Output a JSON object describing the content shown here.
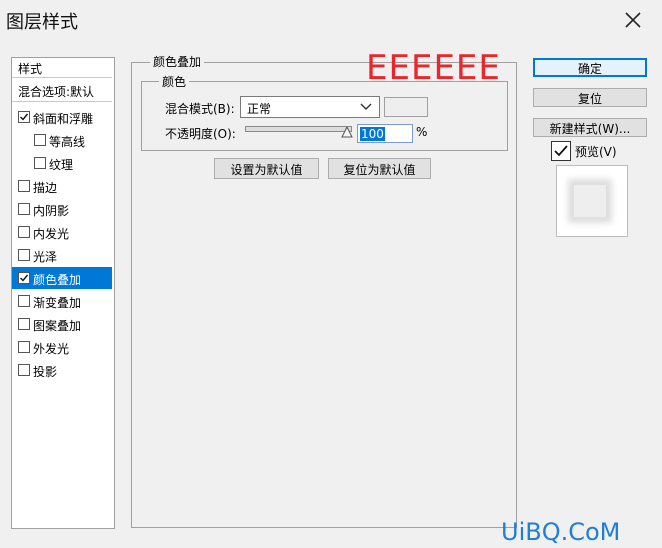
{
  "window": {
    "title": "图层样式"
  },
  "styles_panel": {
    "header": "样式",
    "blend_options": "混合选项:默认",
    "items": [
      {
        "label": "斜面和浮雕",
        "checked": true,
        "indent": false,
        "selected": false
      },
      {
        "label": "等高线",
        "checked": false,
        "indent": true,
        "selected": false
      },
      {
        "label": "纹理",
        "checked": false,
        "indent": true,
        "selected": false
      },
      {
        "label": "描边",
        "checked": false,
        "indent": false,
        "selected": false
      },
      {
        "label": "内阴影",
        "checked": false,
        "indent": false,
        "selected": false
      },
      {
        "label": "内发光",
        "checked": false,
        "indent": false,
        "selected": false
      },
      {
        "label": "光泽",
        "checked": false,
        "indent": false,
        "selected": false
      },
      {
        "label": "颜色叠加",
        "checked": true,
        "indent": false,
        "selected": true
      },
      {
        "label": "渐变叠加",
        "checked": false,
        "indent": false,
        "selected": false
      },
      {
        "label": "图案叠加",
        "checked": false,
        "indent": false,
        "selected": false
      },
      {
        "label": "外发光",
        "checked": false,
        "indent": false,
        "selected": false
      },
      {
        "label": "投影",
        "checked": false,
        "indent": false,
        "selected": false
      }
    ]
  },
  "color_overlay": {
    "group_title": "颜色叠加",
    "sub_group_title": "颜色",
    "blend_mode_label": "混合模式(B):",
    "blend_mode_value": "正常",
    "opacity_label": "不透明度(O):",
    "opacity_value": "100",
    "opacity_unit": "%",
    "opacity_fraction": 1.0,
    "overlay_color": "#eeeeee",
    "set_default_button": "设置为默认值",
    "reset_default_button": "复位为默认值"
  },
  "annotation": {
    "text": "EEEEEE",
    "color": "#e8262c"
  },
  "actions": {
    "ok": "确定",
    "reset": "复位",
    "new_style": "新建样式(W)...",
    "preview_label": "预览(V)",
    "preview_checked": true
  },
  "watermark": {
    "text": "UiBQ.CoM"
  }
}
